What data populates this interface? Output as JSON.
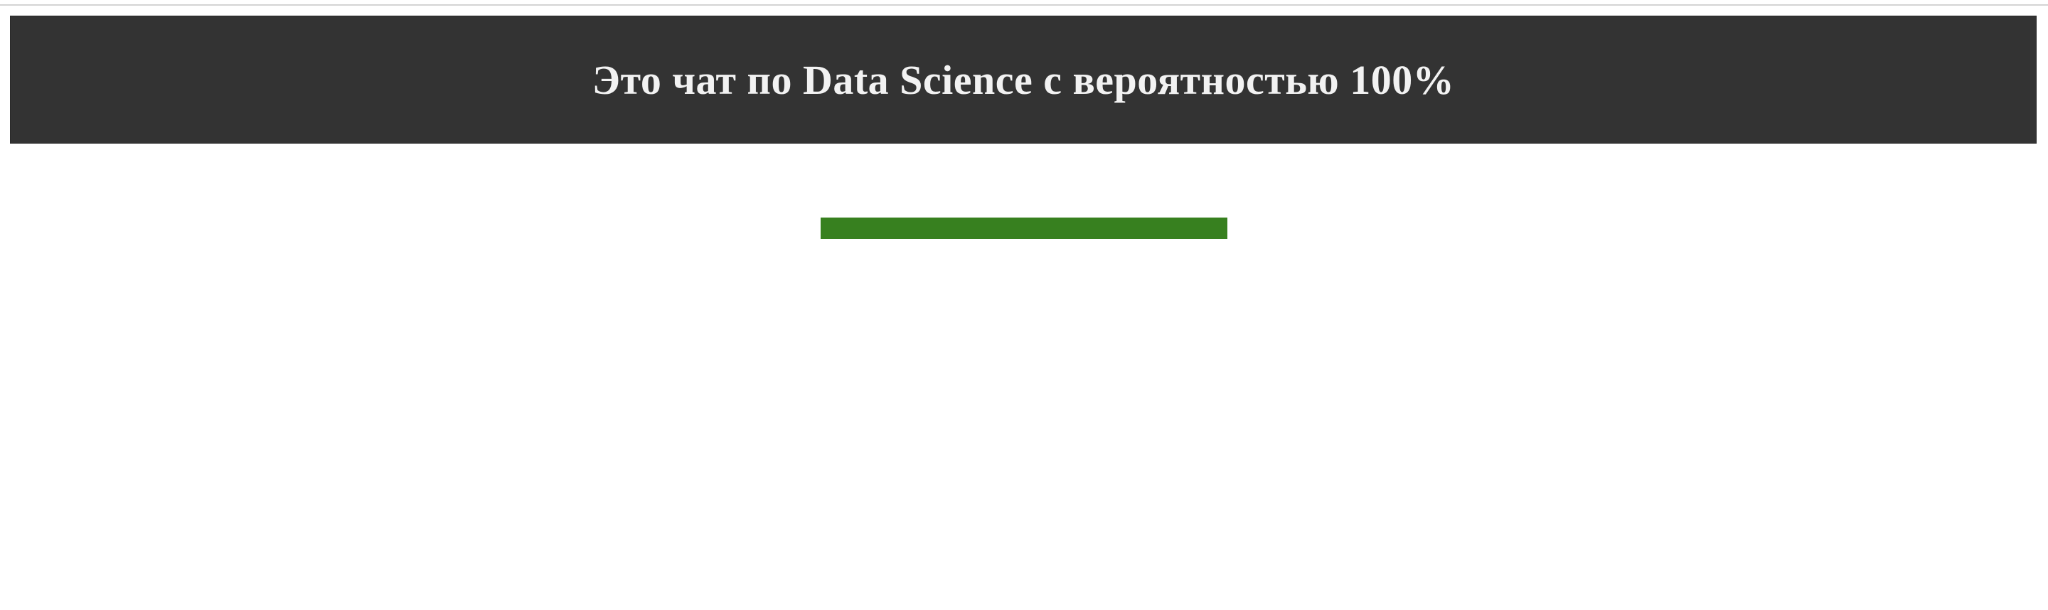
{
  "banner": {
    "title": "Это чат по Data Science с вероятностью 100%",
    "background_color": "#333333",
    "text_color": "#f2f2f2"
  },
  "progress": {
    "value_percent": 100,
    "fill_color": "#37801f"
  }
}
